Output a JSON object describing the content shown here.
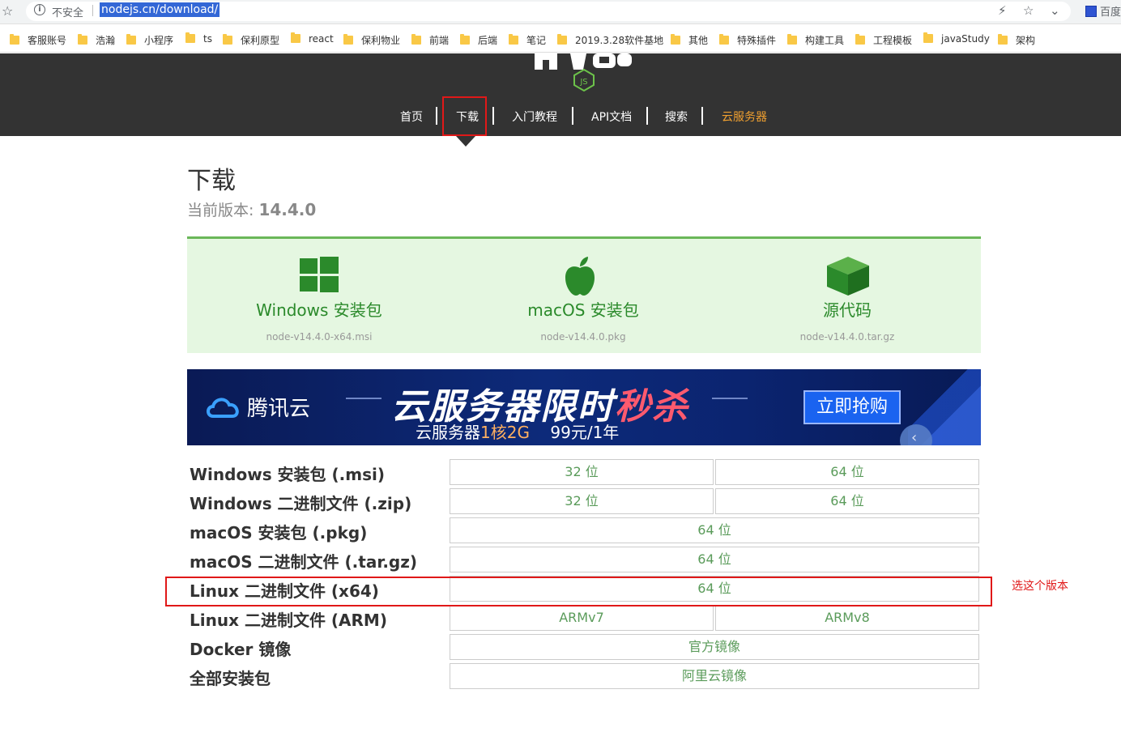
{
  "browser": {
    "insecure_label": "不安全",
    "url": "nodejs.cn/download/",
    "baidu_label": "百度"
  },
  "bookmarks": [
    "客服账号",
    "浩瀚",
    "小程序",
    "ts",
    "保利原型",
    "react",
    "保利物业",
    "前端",
    "后端",
    "笔记",
    "2019.3.28软件基地",
    "其他",
    "特殊插件",
    "构建工具",
    "工程模板",
    "javaStudy",
    "架构"
  ],
  "nav": {
    "items": [
      "首页",
      "下载",
      "入门教程",
      "API文档",
      "搜索",
      "云服务器"
    ],
    "active": "下载",
    "highlight_color": "#f0a030"
  },
  "main": {
    "title": "下载",
    "version_label": "当前版本:",
    "version_value": "14.4.0"
  },
  "downloads": [
    {
      "label": "Windows 安装包",
      "file": "node-v14.4.0-x64.msi",
      "icon": "windows-icon"
    },
    {
      "label": "macOS 安装包",
      "file": "node-v14.4.0.pkg",
      "icon": "apple-icon"
    },
    {
      "label": "源代码",
      "file": "node-v14.4.0.tar.gz",
      "icon": "package-box-icon"
    }
  ],
  "banner": {
    "brand": "腾讯云",
    "headline_main": "云服务器限时",
    "headline_hot": "秒杀",
    "sub_main": "云服务器",
    "sub_accent": "1核2G",
    "sub_price": "99元/1年",
    "cta": "立即抢购"
  },
  "table": {
    "rows": [
      {
        "label": "Windows 安装包 (.msi)",
        "cells": [
          "32 位",
          "64 位"
        ]
      },
      {
        "label": "Windows 二进制文件 (.zip)",
        "cells": [
          "32 位",
          "64 位"
        ]
      },
      {
        "label": "macOS 安装包 (.pkg)",
        "cells": [
          "64 位"
        ]
      },
      {
        "label": "macOS 二进制文件 (.tar.gz)",
        "cells": [
          "64 位"
        ]
      },
      {
        "label": "Linux 二进制文件 (x64)",
        "cells": [
          "64 位"
        ]
      },
      {
        "label": "Linux 二进制文件 (ARM)",
        "cells": [
          "ARMv7",
          "ARMv8"
        ]
      },
      {
        "label": "Docker 镜像",
        "cells": [
          "官方镜像"
        ]
      },
      {
        "label": "全部安装包",
        "cells": [
          "阿里云镜像"
        ]
      }
    ]
  },
  "annotation": {
    "text": "选这个版本",
    "color": "#e01818"
  },
  "colors": {
    "header_bg": "#333333",
    "panel_bg": "#e5f7e1",
    "node_green": "#2b8a2b"
  }
}
